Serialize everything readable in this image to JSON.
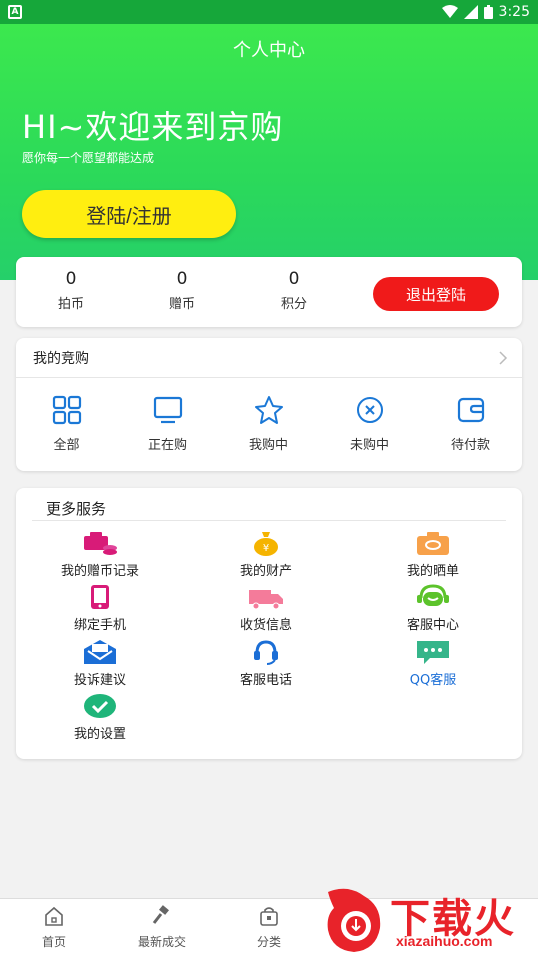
{
  "status_bar": {
    "time": "3:25",
    "left_badge": "A"
  },
  "header": {
    "title": "个人中心"
  },
  "hero": {
    "welcome": "HI~欢迎来到京购",
    "wish": "愿你每一个愿望都能达成",
    "login_button": "登陆/注册"
  },
  "stats": {
    "items": [
      {
        "value": "0",
        "label": "拍币"
      },
      {
        "value": "0",
        "label": "赠币"
      },
      {
        "value": "0",
        "label": "积分"
      }
    ],
    "logout_button": "退出登陆"
  },
  "my_bids": {
    "title": "我的竞购",
    "items": [
      {
        "label": "全部",
        "icon": "grid-icon"
      },
      {
        "label": "正在购",
        "icon": "monitor-icon"
      },
      {
        "label": "我购中",
        "icon": "star-icon"
      },
      {
        "label": "未购中",
        "icon": "x-circle-icon"
      },
      {
        "label": "待付款",
        "icon": "wallet-icon"
      }
    ]
  },
  "services": {
    "title": "更多服务",
    "items": [
      {
        "label": "我的赠币记录",
        "icon": "coins-icon",
        "color": "#d81b78"
      },
      {
        "label": "我的财产",
        "icon": "money-bag-icon",
        "color": "#f5b400"
      },
      {
        "label": "我的晒单",
        "icon": "camera-icon",
        "color": "#f7a14a"
      },
      {
        "label": "绑定手机",
        "icon": "phone-icon",
        "color": "#d81b78"
      },
      {
        "label": "收货信息",
        "icon": "truck-icon",
        "color": "#f47b9a"
      },
      {
        "label": "客服中心",
        "icon": "headset-icon",
        "color": "#5cc32b"
      },
      {
        "label": "投诉建议",
        "icon": "mail-icon",
        "color": "#1b6ed6"
      },
      {
        "label": "客服电话",
        "icon": "phone-support-icon",
        "color": "#1b6ed6"
      },
      {
        "label": "QQ客服",
        "icon": "chat-icon",
        "color": "#35b58a"
      },
      {
        "label": "我的设置",
        "icon": "check-circle-icon",
        "color": "#1fb57a"
      }
    ]
  },
  "bottom_nav": {
    "items": [
      {
        "label": "首页",
        "icon": "home-icon"
      },
      {
        "label": "最新成交",
        "icon": "gavel-icon"
      },
      {
        "label": "分类",
        "icon": "bag-icon"
      }
    ]
  },
  "watermark": {
    "title": "下载火",
    "url": "xiazaihuo.com"
  },
  "colors": {
    "primary_green": "#2bd95a",
    "login_yellow": "#ffee10",
    "logout_red": "#f01a1a",
    "icon_blue": "#1b78d6"
  }
}
